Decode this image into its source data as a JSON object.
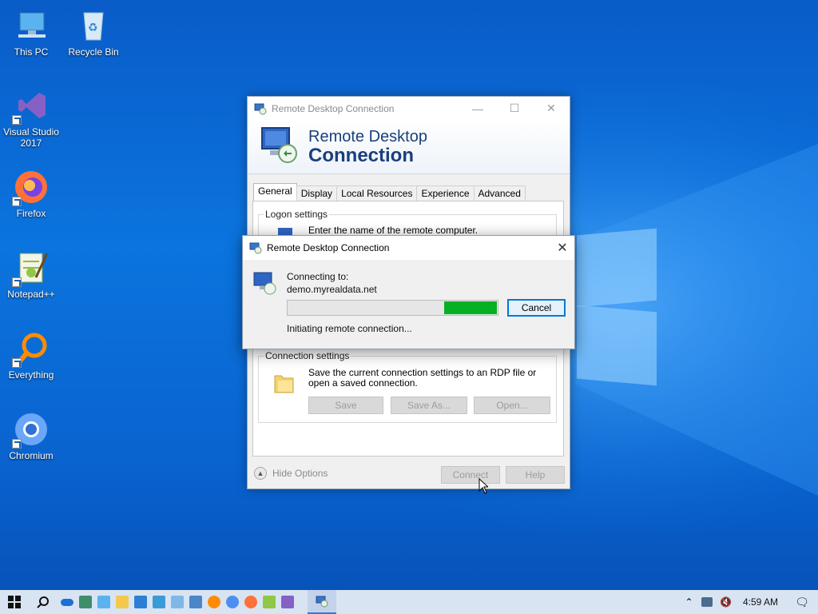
{
  "desktop": {
    "icons": [
      {
        "label": "This PC"
      },
      {
        "label": "Recycle Bin"
      },
      {
        "label": "Visual Studio 2017"
      },
      {
        "label": "Firefox"
      },
      {
        "label": "Notepad++"
      },
      {
        "label": "Everything"
      },
      {
        "label": "Chromium"
      }
    ]
  },
  "rdc_window": {
    "title": "Remote Desktop Connection",
    "banner_line1": "Remote Desktop",
    "banner_line2": "Connection",
    "tabs": [
      {
        "label": "General",
        "active": true
      },
      {
        "label": "Display"
      },
      {
        "label": "Local Resources"
      },
      {
        "label": "Experience"
      },
      {
        "label": "Advanced"
      }
    ],
    "logon_group_label": "Logon settings",
    "logon_hint": "Enter the name of the remote computer.",
    "connection_group_label": "Connection settings",
    "connection_hint": "Save the current connection settings to an RDP file or open a saved connection.",
    "save_label": "Save",
    "save_as_label": "Save As...",
    "open_label": "Open...",
    "hide_options_label": "Hide Options",
    "connect_label": "Connect",
    "help_label": "Help"
  },
  "connecting_dialog": {
    "title": "Remote Desktop Connection",
    "connecting_label": "Connecting to:",
    "host": "demo.myrealdata.net",
    "status": "Initiating remote connection...",
    "cancel_label": "Cancel",
    "progress_fill_fraction": 0.25
  },
  "taskbar": {
    "clock": "4:59 AM",
    "pinned_icons": [
      "onedrive-icon",
      "people-icon",
      "this-pc-icon",
      "file-explorer-icon",
      "network-icon",
      "control-panel-icon",
      "notepad-icon",
      "everything-icon",
      "chromium-icon",
      "firefox-icon",
      "notepadpp-icon",
      "visual-studio-icon"
    ],
    "active_app_icon": "remote-desktop-icon",
    "colors": {
      "accent": "#0078d7",
      "progress": "#06b025",
      "taskbar": "#d9e4f2"
    }
  }
}
